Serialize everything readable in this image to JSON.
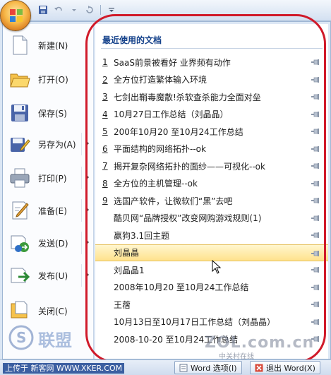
{
  "quick_access": {
    "icons": [
      "save-icon",
      "undo-icon",
      "redo-icon",
      "customize-qat-icon"
    ]
  },
  "menu": {
    "commands": [
      {
        "label": "新建(N)",
        "icon": "new-document-icon",
        "has_submenu": false
      },
      {
        "label": "打开(O)",
        "icon": "open-folder-icon",
        "has_submenu": false
      },
      {
        "label": "保存(S)",
        "icon": "save-disk-icon",
        "has_submenu": false
      },
      {
        "label": "另存为(A)",
        "icon": "save-as-icon",
        "has_submenu": true
      },
      {
        "label": "打印(P)",
        "icon": "printer-icon",
        "has_submenu": true
      },
      {
        "label": "准备(E)",
        "icon": "prepare-icon",
        "has_submenu": true
      },
      {
        "label": "发送(D)",
        "icon": "send-icon",
        "has_submenu": true
      },
      {
        "label": "发布(U)",
        "icon": "publish-icon",
        "has_submenu": true
      },
      {
        "label": "关闭(C)",
        "icon": "close-document-icon",
        "has_submenu": false
      }
    ],
    "recent_title": "最近使用的文档",
    "recent": [
      {
        "num": "1",
        "text": "SaaS前景被看好  业界频有动作"
      },
      {
        "num": "2",
        "text": "全方位打造繁体输入环境"
      },
      {
        "num": "3",
        "text": "七剑出鞘毒魔散!杀软查杀能力全面对垒"
      },
      {
        "num": "4",
        "text": "10月27日工作总结（刘晶晶）"
      },
      {
        "num": "5",
        "text": "200年10月20 至10月24工作总结"
      },
      {
        "num": "6",
        "text": "平面结构的网络拓扑--ok"
      },
      {
        "num": "7",
        "text": "揭开复杂网络拓扑的面纱——可视化--ok"
      },
      {
        "num": "8",
        "text": "全方位的主机管理--ok"
      },
      {
        "num": "9",
        "text": "选国产软件，让微软们“黑”去吧"
      },
      {
        "num": "",
        "text": "酷贝网“品牌授权”改变网购游戏规则(1)"
      },
      {
        "num": "",
        "text": "赢狗3.1回主题"
      },
      {
        "num": "",
        "text": "刘晶晶"
      },
      {
        "num": "",
        "text": "刘晶晶1"
      },
      {
        "num": "",
        "text": "2008年10月20 至10月24工作总结"
      },
      {
        "num": "",
        "text": "王蓿"
      },
      {
        "num": "",
        "text": "10月13日至10月17日工作总结（刘晶晶）"
      },
      {
        "num": "",
        "text": "2008-10-20 至10月24工作总结"
      }
    ],
    "highlighted_index": 11
  },
  "bottom": {
    "upload_text": "上传于 新客网 WWW.XKER.COM",
    "options_label": "Word 选项(I)",
    "exit_label": "退出 Word(X)"
  },
  "watermarks": {
    "right_text": "ZOL.com.cn",
    "right_sub": "中关村在线",
    "left_text": "联盟"
  },
  "colors": {
    "annotation": "#d01a2a",
    "highlight": "#ffe28c",
    "title_blue": "#15428b"
  }
}
